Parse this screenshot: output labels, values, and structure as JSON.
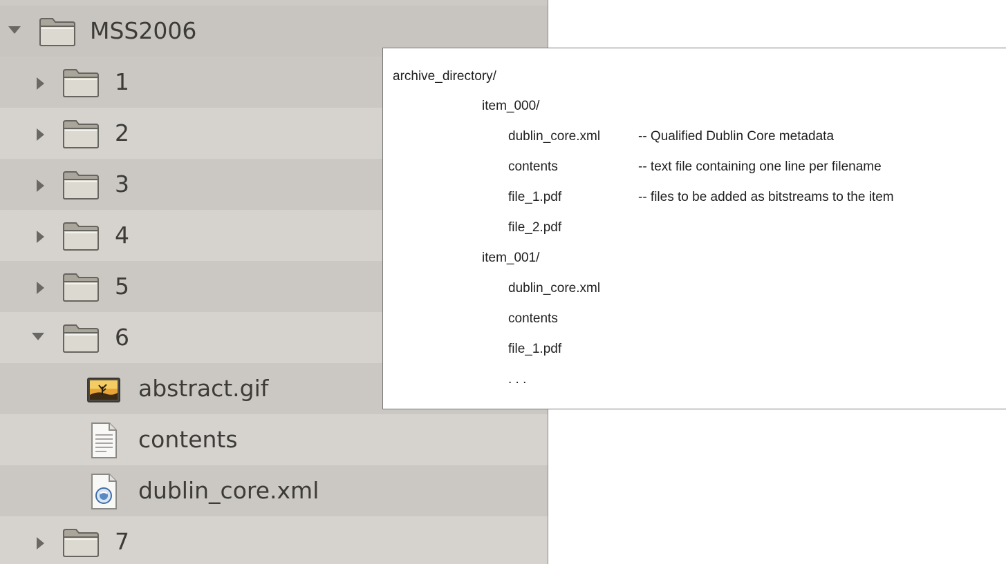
{
  "file_tree": {
    "rows": [
      {
        "label": "MSS2006",
        "type": "folder",
        "expanded": true
      },
      {
        "label": "1",
        "type": "folder",
        "expanded": false
      },
      {
        "label": "2",
        "type": "folder",
        "expanded": false
      },
      {
        "label": "3",
        "type": "folder",
        "expanded": false
      },
      {
        "label": "4",
        "type": "folder",
        "expanded": false
      },
      {
        "label": "5",
        "type": "folder",
        "expanded": false
      },
      {
        "label": "6",
        "type": "folder",
        "expanded": true
      },
      {
        "label": "abstract.gif",
        "type": "image-file",
        "icon": "image-file-icon"
      },
      {
        "label": "contents",
        "type": "text-file",
        "icon": "text-file-icon"
      },
      {
        "label": "dublin_core.xml",
        "type": "xml-file",
        "icon": "xml-file-icon"
      },
      {
        "label": "7",
        "type": "folder",
        "expanded": false
      }
    ]
  },
  "structure_panel": {
    "root": "archive_directory/",
    "item_000": "item_000/",
    "item_000_dc": "dublin_core.xml",
    "item_000_dc_note": "-- Qualified Dublin Core metadata",
    "item_000_contents": "contents",
    "item_000_contents_note": "-- text file containing one line per filename",
    "item_000_file1": "file_1.pdf",
    "item_000_file1_note": "-- files to be added as bitstreams to the item",
    "item_000_file2": "file_2.pdf",
    "item_001": "item_001/",
    "item_001_dc": "dublin_core.xml",
    "item_001_contents": "contents",
    "item_001_file1": "file_1.pdf",
    "ellipsis": ". . ."
  },
  "colors": {
    "tree_bg": "#d6d3cf",
    "tree_text": "#3c3b37",
    "folder_fill": "#d9d6cc",
    "panel_bg": "#ffffff"
  }
}
